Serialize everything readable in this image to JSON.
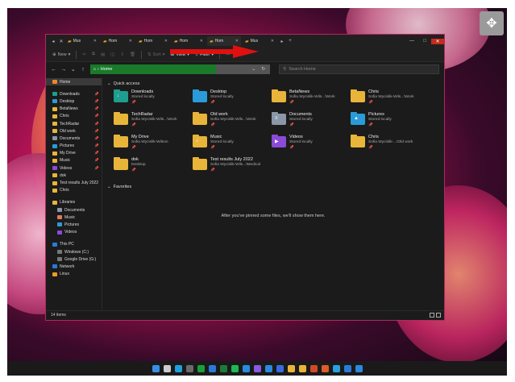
{
  "tabs": [
    {
      "label": "Mus",
      "active": false
    },
    {
      "label": "Hom",
      "active": false
    },
    {
      "label": "Hom",
      "active": false
    },
    {
      "label": "Hom",
      "active": false
    },
    {
      "label": "Hom",
      "active": true
    },
    {
      "label": "Mus",
      "active": false
    }
  ],
  "toolbar": {
    "new": "New",
    "sort": "Sort",
    "view": "View",
    "filter": "Filter",
    "more": "···"
  },
  "address": {
    "path": "Home",
    "search_placeholder": "Search Home"
  },
  "sidebar": {
    "home": "Home",
    "pinned": [
      "Downloads",
      "Desktop",
      "BetaNews",
      "Chris",
      "TechRadar",
      "Old work",
      "Documents",
      "Pictures",
      "My Drive",
      "Music",
      "Videos",
      "dok",
      "Test results July 2022",
      "Chris"
    ],
    "libraries": [
      "Libraries",
      "Documents",
      "Music",
      "Pictures",
      "Videos"
    ],
    "this_pc": [
      "This PC",
      "Windows (C:)",
      "Google Drive (G:)"
    ],
    "network": "Network",
    "linux": "Linux"
  },
  "quick_access": {
    "heading": "Quick access",
    "items": [
      {
        "name": "Downloads",
        "sub": "Stored locally",
        "color": "#1e9e8e",
        "glyph": "↓"
      },
      {
        "name": "Desktop",
        "sub": "Stored locally",
        "color": "#2a9bd8",
        "glyph": ""
      },
      {
        "name": "BetaNews",
        "sub": "Sofia Wycislik-Wils...\\Work",
        "color": "#e8b53a",
        "glyph": ""
      },
      {
        "name": "Chris",
        "sub": "Sofia Wycislik-Wils...\\Work",
        "color": "#e8b53a",
        "glyph": ""
      },
      {
        "name": "TechRadar",
        "sub": "Sofia Wycislik-Wils...\\Work",
        "color": "#e8b53a",
        "glyph": ""
      },
      {
        "name": "Old work",
        "sub": "Sofia Wycislik-Wils...\\Work",
        "color": "#e8b53a",
        "glyph": ""
      },
      {
        "name": "Documents",
        "sub": "Stored locally",
        "color": "#8a97a8",
        "glyph": "≡"
      },
      {
        "name": "Pictures",
        "sub": "Stored locally",
        "color": "#2a9bd8",
        "glyph": "▲"
      },
      {
        "name": "My Drive",
        "sub": "Sofia Wycislik-Wilson",
        "color": "#e8b53a",
        "glyph": ""
      },
      {
        "name": "Music",
        "sub": "Stored locally",
        "color": "#e8b53a",
        "glyph": "♪"
      },
      {
        "name": "Videos",
        "sub": "Stored locally",
        "color": "#8b4ad8",
        "glyph": "▶"
      },
      {
        "name": "Chris",
        "sub": "Sofia Wycislik-...\\Old work",
        "color": "#e8b53a",
        "glyph": ""
      },
      {
        "name": "dok",
        "sub": "Desktop",
        "color": "#e8b53a",
        "glyph": ""
      },
      {
        "name": "Test results July 2022",
        "sub": "Sofia Wycislik-Wils...\\Medical",
        "color": "#e8b53a",
        "glyph": ""
      }
    ]
  },
  "favorites": {
    "heading": "Favorites",
    "empty": "After you've pinned some files, we'll show them here."
  },
  "status": {
    "items": "14 items"
  },
  "colors": {
    "address_green": "#1a7a2a",
    "arrow_red": "#e01010",
    "window_border": "#b02a5e"
  }
}
